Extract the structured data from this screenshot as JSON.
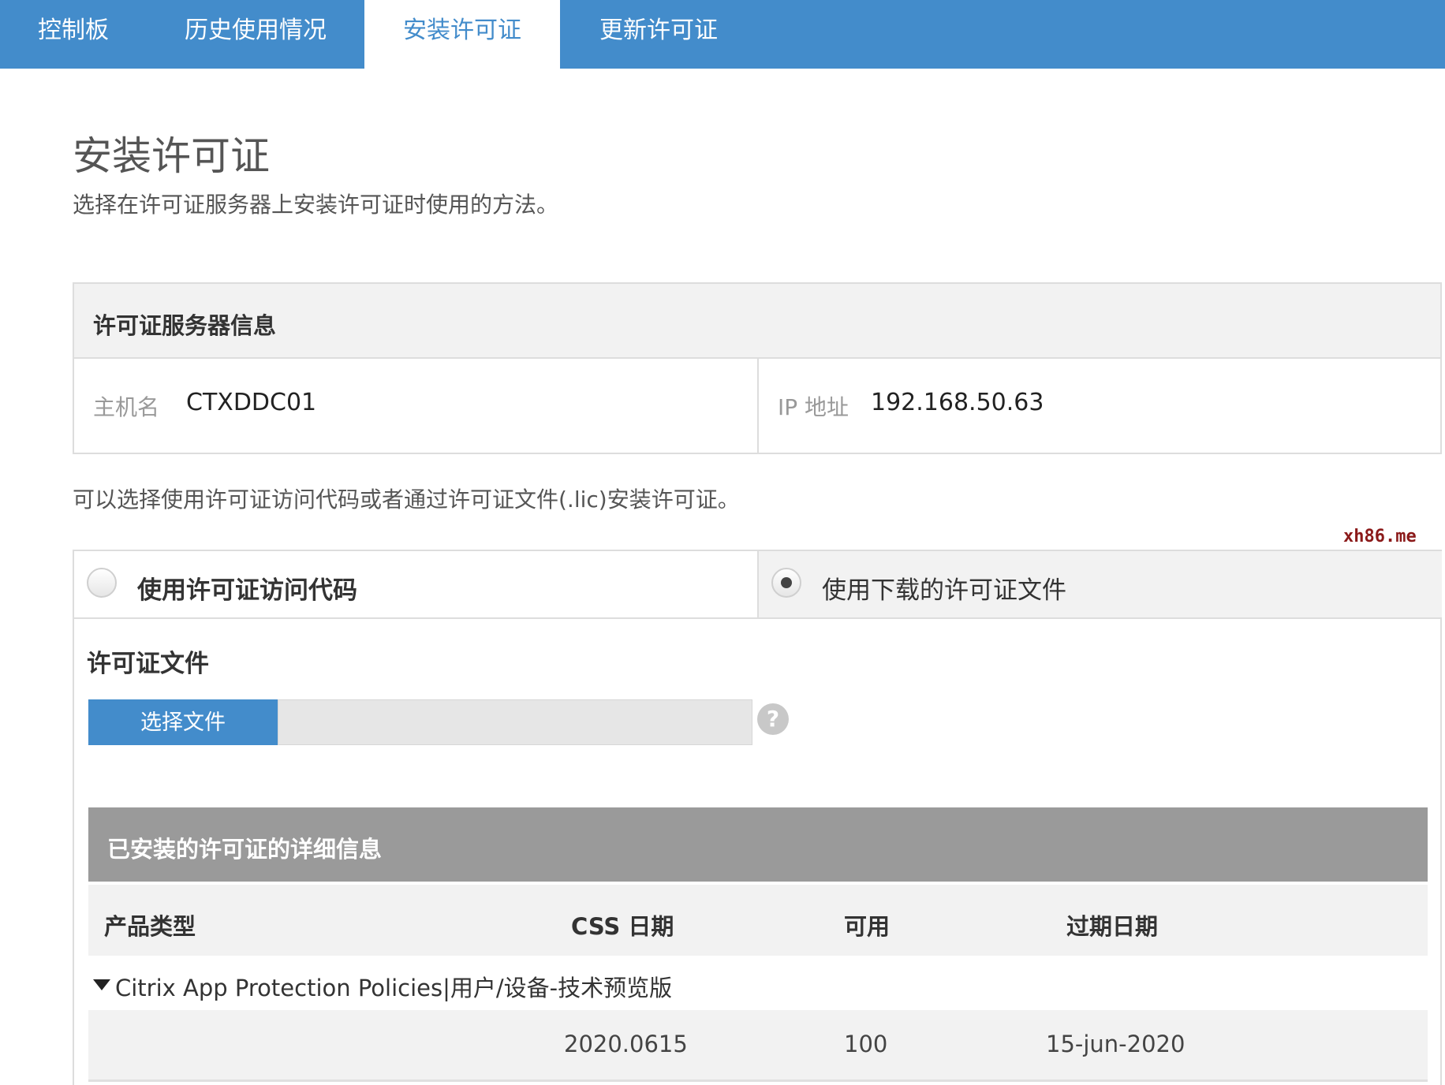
{
  "nav": {
    "tabs": [
      {
        "label": "控制板",
        "active": false
      },
      {
        "label": "历史使用情况",
        "active": false
      },
      {
        "label": "安装许可证",
        "active": true
      },
      {
        "label": "更新许可证",
        "active": false
      }
    ]
  },
  "page": {
    "title": "安装许可证",
    "description": "选择在许可证服务器上安装许可证时使用的方法。"
  },
  "server_info": {
    "title": "许可证服务器信息",
    "hostname_label": "主机名",
    "hostname_value": "CTXDDC01",
    "ip_label": "IP 地址",
    "ip_value": "192.168.50.63"
  },
  "method_note": "可以选择使用许可证访问代码或者通过许可证文件(.lic)安装许可证。",
  "watermark": "xh86.me",
  "options": {
    "access_code_label": "使用许可证访问代码",
    "access_code_selected": false,
    "file_label": "使用下载的许可证文件",
    "file_selected": true
  },
  "license_file": {
    "title": "许可证文件",
    "choose_button": "选择文件",
    "file_value": "",
    "help_icon": "question-circle-icon"
  },
  "installed": {
    "title": "已安装的许可证的详细信息",
    "columns": [
      "产品类型",
      "CSS 日期",
      "可用",
      "过期日期"
    ],
    "products": [
      {
        "name": "Citrix App Protection Policies|用户/设备-技术预览版",
        "expanded": true,
        "rows": [
          {
            "css_date": "2020.0615",
            "available": "100",
            "expiry": "15-jun-2020"
          }
        ]
      }
    ]
  },
  "colors": {
    "accent": "#438ccb",
    "header_gray": "#9a9a9a",
    "panel_gray": "#f2f2f2",
    "watermark": "#8b1a1a"
  }
}
